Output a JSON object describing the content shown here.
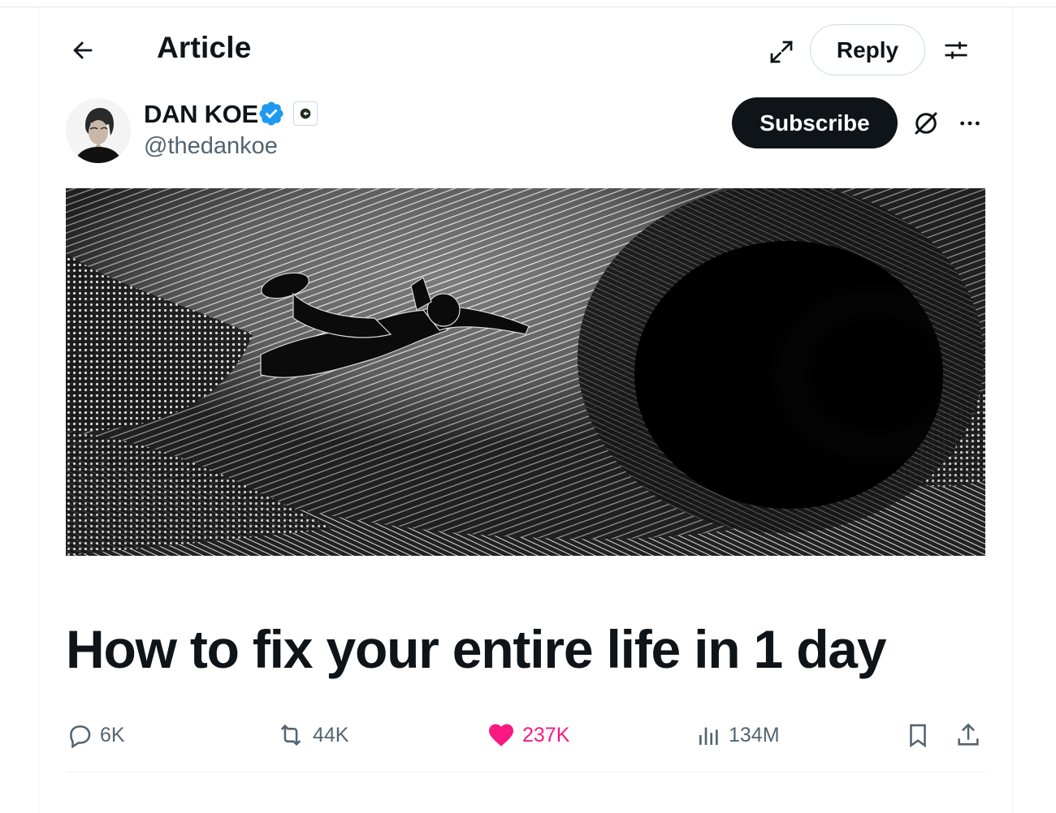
{
  "header": {
    "title": "Article",
    "reply_label": "Reply"
  },
  "author": {
    "name": "DAN KOE",
    "handle": "@thedankoe",
    "subscribe_label": "Subscribe"
  },
  "article": {
    "title": "How to fix your entire life in 1 day"
  },
  "stats": {
    "replies": "6K",
    "reposts": "44K",
    "likes": "237K",
    "views": "134M"
  },
  "colors": {
    "verified": "#1d9bf0",
    "like": "#f91880",
    "text_secondary": "#536471",
    "button_dark": "#0f1419"
  },
  "icons": [
    "back-arrow-icon",
    "expand-icon",
    "settings-icon",
    "verified-icon",
    "affiliate-badge-icon",
    "grok-icon",
    "more-icon",
    "reply-icon",
    "repost-icon",
    "heart-icon",
    "views-icon",
    "bookmark-icon",
    "share-icon"
  ]
}
